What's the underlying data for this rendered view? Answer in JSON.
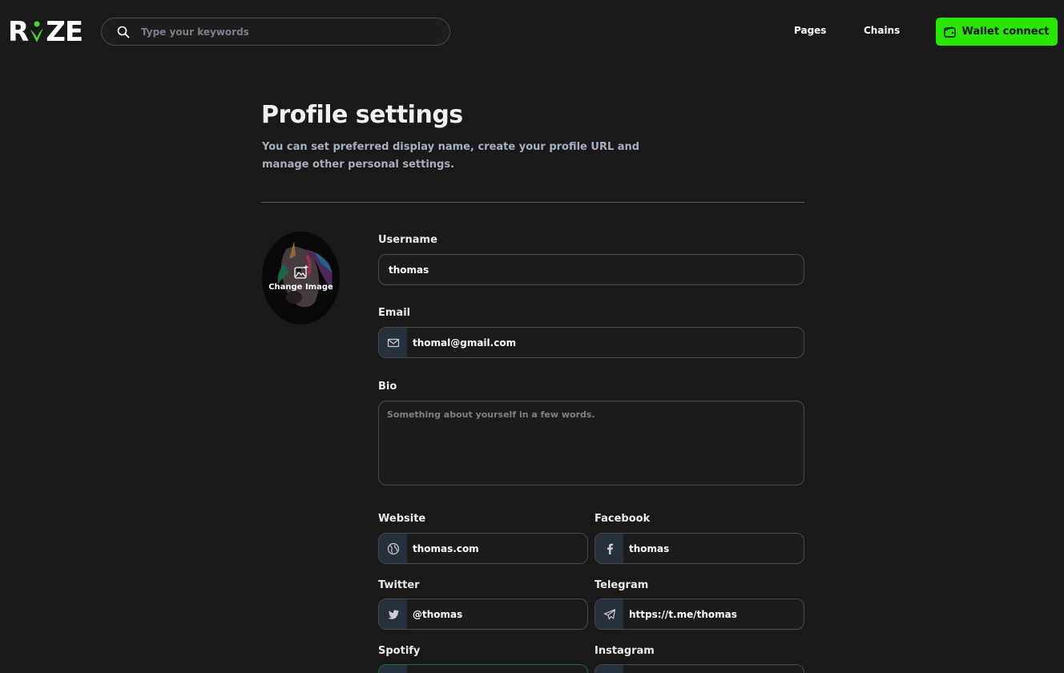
{
  "header": {
    "logo": "RiZE",
    "search_placeholder": "Type your keywords",
    "nav": {
      "pages": "Pages",
      "chains": "Chains"
    },
    "wallet_button": "Wallet connect"
  },
  "page": {
    "title": "Profile settings",
    "subtitle": "You can set preferred display name, create your profile URL and manage other personal settings."
  },
  "avatar": {
    "change_label": "Change Image"
  },
  "form": {
    "username": {
      "label": "Username",
      "value": "thomas"
    },
    "email": {
      "label": "Email",
      "value": "thomal@gmail.com"
    },
    "bio": {
      "label": "Bio",
      "placeholder": "Something about yourself in a few words.",
      "value": ""
    },
    "website": {
      "label": "Website",
      "value": "thomas.com"
    },
    "facebook": {
      "label": "Facebook",
      "value": "thomas"
    },
    "twitter": {
      "label": "Twitter",
      "value": "@thomas"
    },
    "telegram": {
      "label": "Telegram",
      "value": "https://t.me/thomas"
    },
    "spotify": {
      "label": "Spotify",
      "value": ""
    },
    "instagram": {
      "label": "Instagram",
      "value": ""
    }
  },
  "colors": {
    "background": "#191919",
    "accent": "#27e600",
    "addon": "#27303d"
  },
  "icons": {
    "search": "search-icon",
    "wallet": "wallet-icon",
    "image": "image-icon",
    "email": "mail-icon",
    "website": "globe-icon",
    "facebook": "facebook-icon",
    "twitter": "twitter-icon",
    "telegram": "telegram-icon"
  }
}
